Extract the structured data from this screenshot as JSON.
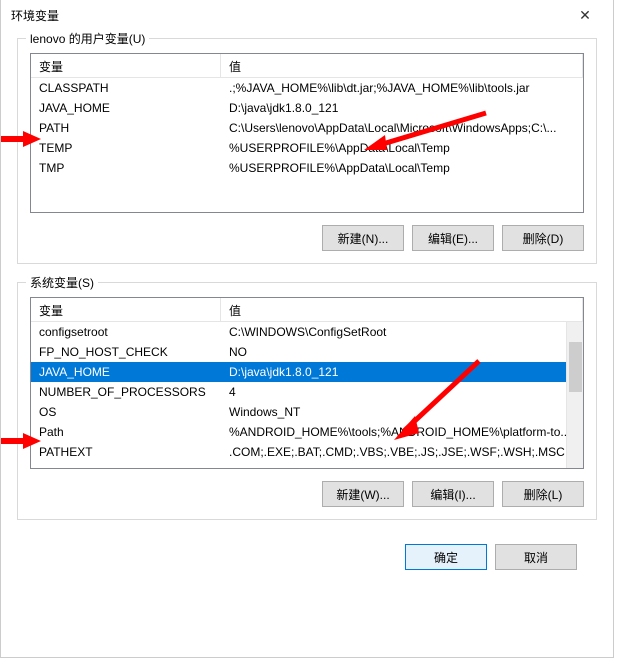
{
  "window": {
    "title": "环境变量",
    "close_glyph": "✕"
  },
  "user_group": {
    "label": "lenovo 的用户变量(U)",
    "col_var": "变量",
    "col_val": "值",
    "rows": [
      {
        "name": "CLASSPATH",
        "value": ".;%JAVA_HOME%\\lib\\dt.jar;%JAVA_HOME%\\lib\\tools.jar"
      },
      {
        "name": "JAVA_HOME",
        "value": "D:\\java\\jdk1.8.0_121"
      },
      {
        "name": "PATH",
        "value": "C:\\Users\\lenovo\\AppData\\Local\\Microsoft\\WindowsApps;C:\\..."
      },
      {
        "name": "TEMP",
        "value": "%USERPROFILE%\\AppData\\Local\\Temp"
      },
      {
        "name": "TMP",
        "value": "%USERPROFILE%\\AppData\\Local\\Temp"
      }
    ],
    "buttons": {
      "new": "新建(N)...",
      "edit": "编辑(E)...",
      "delete": "删除(D)"
    }
  },
  "sys_group": {
    "label": "系统变量(S)",
    "col_var": "变量",
    "col_val": "值",
    "selected_index": 2,
    "rows": [
      {
        "name": "configsetroot",
        "value": "C:\\WINDOWS\\ConfigSetRoot"
      },
      {
        "name": "FP_NO_HOST_CHECK",
        "value": "NO"
      },
      {
        "name": "JAVA_HOME",
        "value": "D:\\java\\jdk1.8.0_121"
      },
      {
        "name": "NUMBER_OF_PROCESSORS",
        "value": "4"
      },
      {
        "name": "OS",
        "value": "Windows_NT"
      },
      {
        "name": "Path",
        "value": "%ANDROID_HOME%\\tools;%ANDROID_HOME%\\platform-to..."
      },
      {
        "name": "PATHEXT",
        "value": ".COM;.EXE;.BAT;.CMD;.VBS;.VBE;.JS;.JSE;.WSF;.WSH;.MSC"
      }
    ],
    "buttons": {
      "new": "新建(W)...",
      "edit": "编辑(I)...",
      "delete": "删除(L)"
    }
  },
  "dialog_buttons": {
    "ok": "确定",
    "cancel": "取消"
  }
}
